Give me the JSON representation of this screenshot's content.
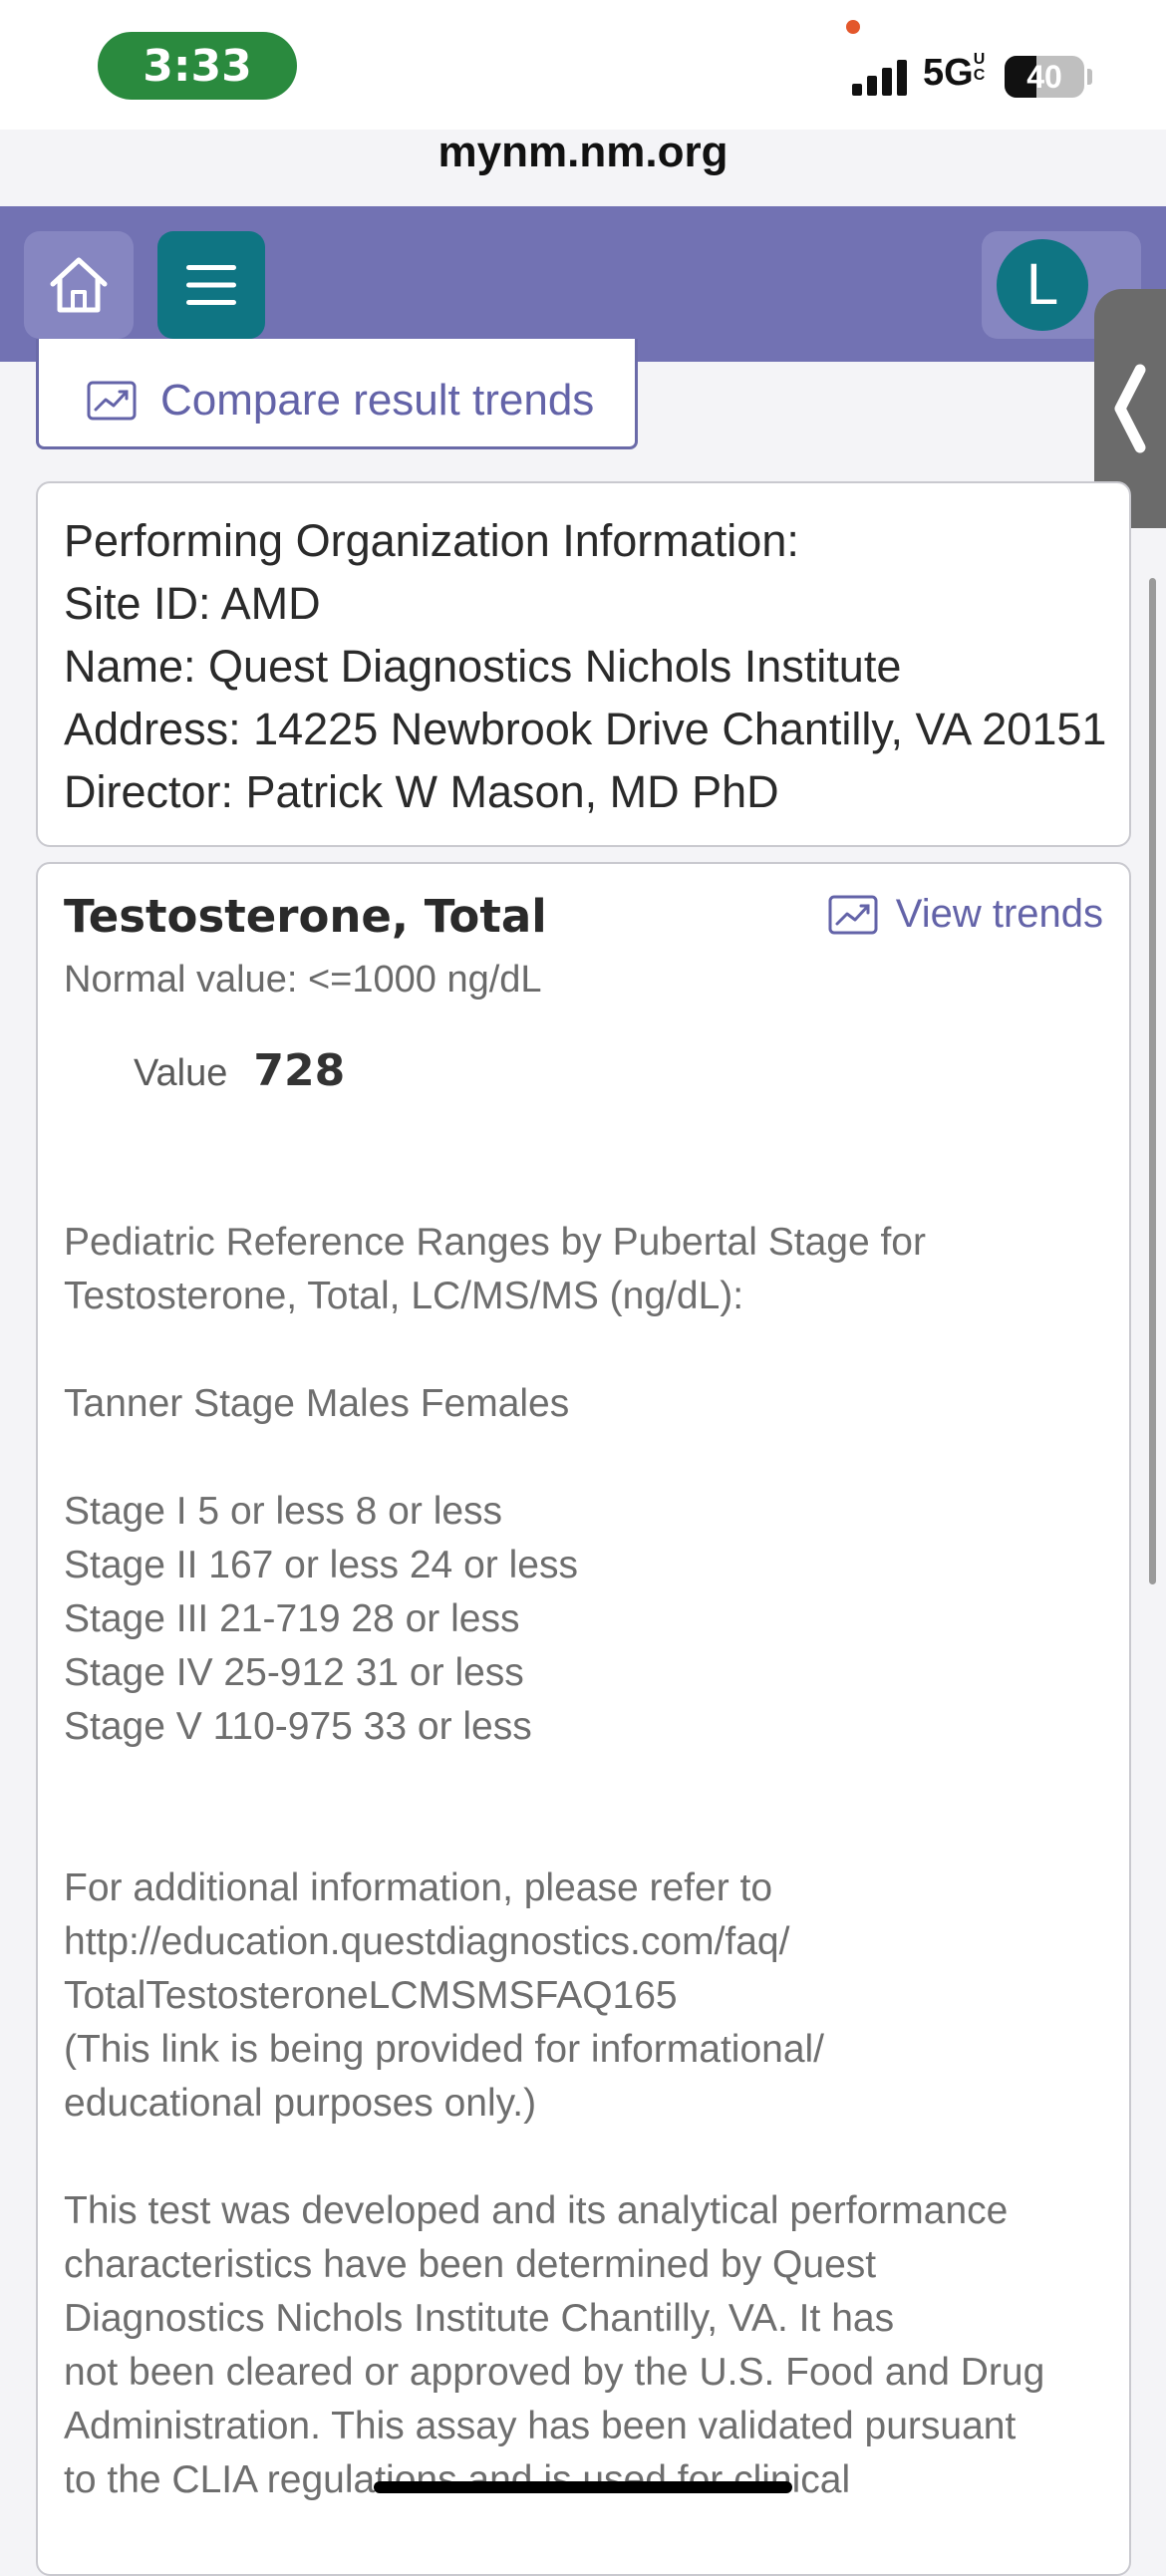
{
  "status_bar": {
    "time": "3:33",
    "network": "5G",
    "network_superscript": "UC",
    "battery": "40",
    "battery_level_percent": 40
  },
  "browser": {
    "url": "mynm.nm.org"
  },
  "header": {
    "home_icon": "home-icon",
    "menu_icon": "hamburger-menu-icon",
    "avatar_initial": "L"
  },
  "compare_button": {
    "label": "Compare result trends",
    "icon": "trend-chart-icon"
  },
  "performing_org": {
    "lines": [
      "Performing Organization Information:",
      "Site ID: AMD",
      "Name: Quest Diagnostics Nichols Institute",
      "Address: 14225 Newbrook Drive Chantilly, VA 20151",
      "Director: Patrick W Mason, MD PhD"
    ]
  },
  "result": {
    "title": "Testosterone, Total",
    "view_trends_label": "View trends",
    "normal_value": "Normal value: <=1000 ng/dL",
    "value_label": "Value",
    "value": "728",
    "comment": "Pediatric Reference Ranges by Pubertal Stage for\nTestosterone, Total, LC/MS/MS (ng/dL):\n\nTanner Stage Males Females\n\nStage I 5 or less 8 or less\nStage II 167 or less 24 or less\nStage III 21-719 28 or less\nStage IV 25-912 31 or less\nStage V 110-975 33 or less\n\n\nFor additional information, please refer to\nhttp://education.questdiagnostics.com/faq/\nTotalTestosteroneLCMSMSFAQ165\n(This link is being provided for informational/\neducational purposes only.)\n\nThis test was developed and its analytical performance\ncharacteristics have been determined by Quest\nDiagnostics Nichols Institute Chantilly, VA. It has\nnot been cleared or approved by the U.S. Food and Drug\nAdministration. This assay has been validated pursuant\nto the CLIA regulations and is used for clinical"
  },
  "colors": {
    "header_bg": "#7272b3",
    "accent_teal": "#0f7583",
    "link_purple": "#6363a8",
    "status_green": "#2a8a3e"
  }
}
